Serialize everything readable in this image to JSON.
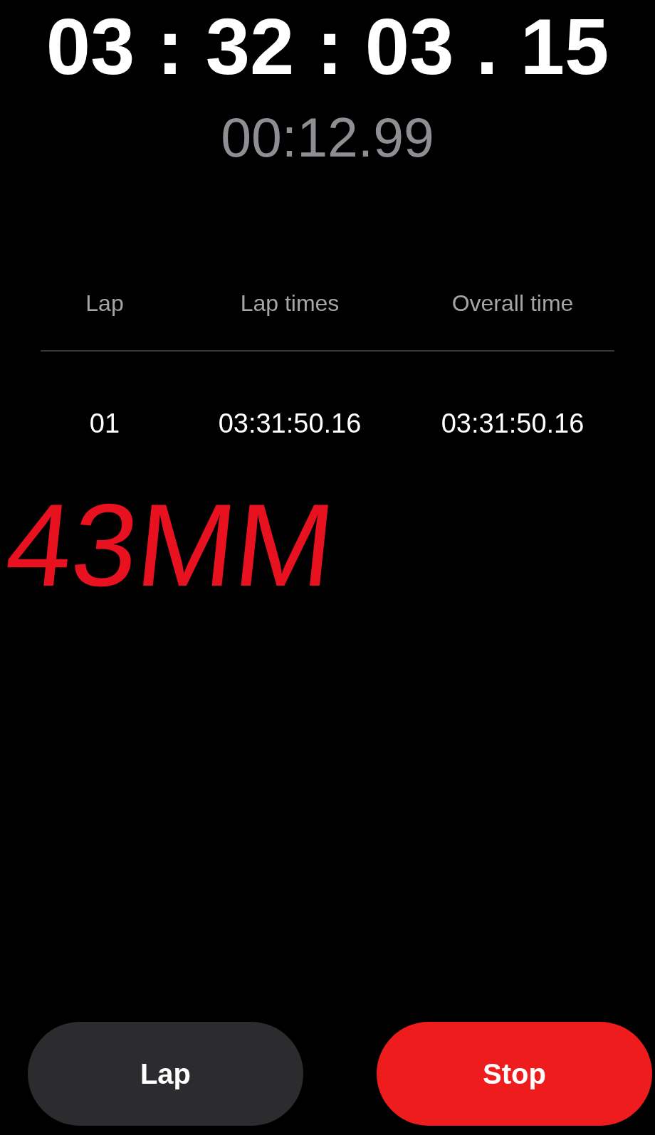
{
  "elapsed": "03 : 32 : 03 . 15",
  "current_lap": "00:12.99",
  "laps_table": {
    "columns": [
      "Lap",
      "Lap times",
      "Overall time"
    ],
    "rows": [
      [
        "01",
        "03:31:50.16",
        "03:31:50.16"
      ]
    ]
  },
  "annotation": "43MM",
  "buttons": [
    {
      "label": "Lap",
      "kind": "secondary"
    },
    {
      "label": "Stop",
      "kind": "primary"
    }
  ]
}
